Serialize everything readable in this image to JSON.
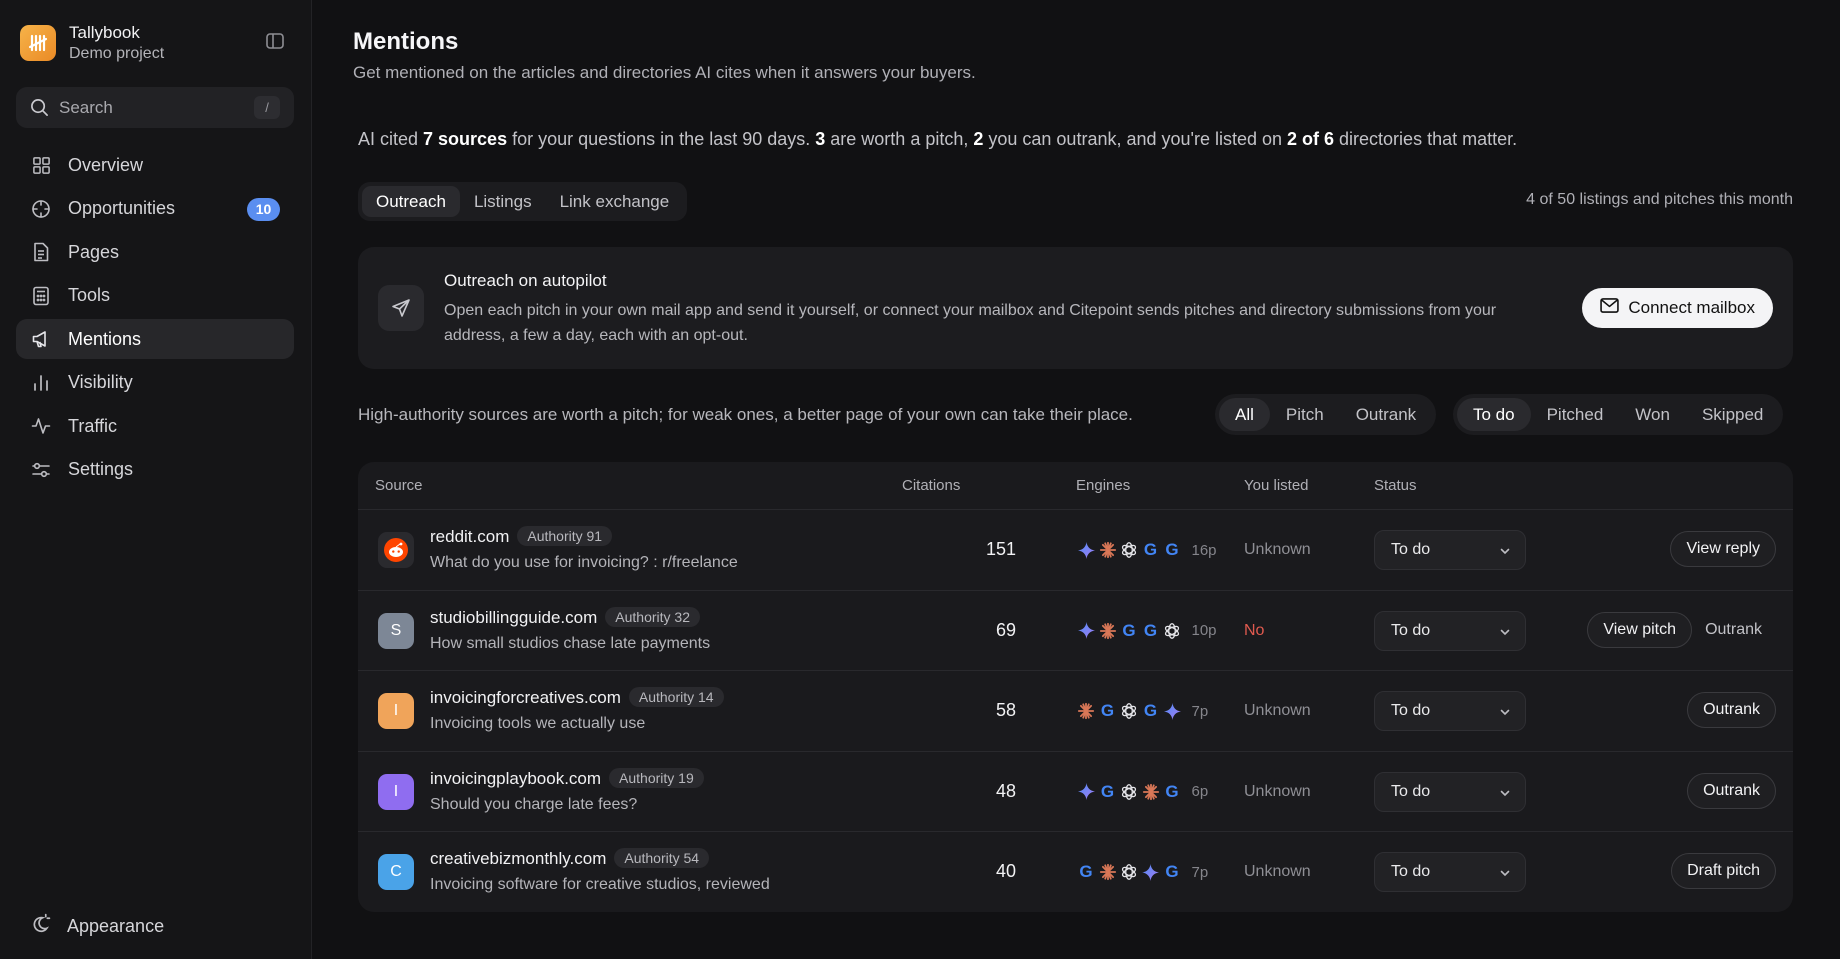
{
  "app": {
    "name": "Tallybook",
    "project": "Demo project"
  },
  "search": {
    "label": "Search",
    "shortcut": "/"
  },
  "nav": [
    {
      "label": "Overview",
      "icon": "grid-icon"
    },
    {
      "label": "Opportunities",
      "icon": "crosshair-icon",
      "badge": "10"
    },
    {
      "label": "Pages",
      "icon": "document-icon"
    },
    {
      "label": "Tools",
      "icon": "calculator-icon"
    },
    {
      "label": "Mentions",
      "icon": "megaphone-icon",
      "active": true
    },
    {
      "label": "Visibility",
      "icon": "bar-chart-icon"
    },
    {
      "label": "Traffic",
      "icon": "activity-icon"
    },
    {
      "label": "Settings",
      "icon": "sliders-icon"
    }
  ],
  "appearance_label": "Appearance",
  "page": {
    "title": "Mentions",
    "subtitle": "Get mentioned on the articles and directories AI cites when it answers your buyers."
  },
  "summary": {
    "p1": "AI cited ",
    "sources": "7 sources",
    "p2": " for your questions in the last 90 days. ",
    "pitch_count": "3",
    "p3": " are worth a pitch, ",
    "outrank_count": "2",
    "p4": " you can outrank, and you're listed on ",
    "directories": "2 of 6",
    "p5": " directories that matter."
  },
  "tabs": [
    "Outreach",
    "Listings",
    "Link exchange"
  ],
  "quota": "4 of 50 listings and pitches this month",
  "autopilot": {
    "title": "Outreach on autopilot",
    "description": "Open each pitch in your own mail app and send it yourself, or connect your mailbox and Citepoint sends pitches and directory submissions from your address, a few a day, each with an opt-out.",
    "button": "Connect mailbox"
  },
  "filter": {
    "text": "High-authority sources are worth a pitch; for weak ones, a better page of your own can take their place.",
    "types": [
      "All",
      "Pitch",
      "Outrank"
    ],
    "statuses": [
      "To do",
      "Pitched",
      "Won",
      "Skipped"
    ]
  },
  "table": {
    "headers": {
      "source": "Source",
      "citations": "Citations",
      "engines": "Engines",
      "listed": "You listed",
      "status": "Status"
    },
    "rows": [
      {
        "domain": "reddit.com",
        "authority": "Authority 91",
        "title": "What do you use for invoicing? : r/freelance",
        "citations": "151",
        "engines": [
          "gemini",
          "claude",
          "openai",
          "google",
          "google"
        ],
        "pages": "16p",
        "listed": "Unknown",
        "status": "To do",
        "avatar": "R",
        "avatar_color": "#ff4500",
        "actions": [
          "View reply"
        ]
      },
      {
        "domain": "studiobillingguide.com",
        "authority": "Authority 32",
        "title": "How small studios chase late payments",
        "citations": "69",
        "engines": [
          "gemini",
          "claude",
          "google",
          "google",
          "openai"
        ],
        "pages": "10p",
        "listed": "No",
        "status": "To do",
        "avatar": "S",
        "avatar_color": "#7d8796",
        "actions": [
          "View pitch",
          "Outrank"
        ]
      },
      {
        "domain": "invoicingforcreatives.com",
        "authority": "Authority 14",
        "title": "Invoicing tools we actually use",
        "citations": "58",
        "engines": [
          "claude",
          "google",
          "openai",
          "google",
          "gemini"
        ],
        "pages": "7p",
        "listed": "Unknown",
        "status": "To do",
        "avatar": "I",
        "avatar_color": "#f0a45a",
        "actions": [
          "Outrank"
        ]
      },
      {
        "domain": "invoicingplaybook.com",
        "authority": "Authority 19",
        "title": "Should you charge late fees?",
        "citations": "48",
        "engines": [
          "gemini",
          "google",
          "openai",
          "claude",
          "google"
        ],
        "pages": "6p",
        "listed": "Unknown",
        "status": "To do",
        "avatar": "I",
        "avatar_color": "#8f6df0",
        "actions": [
          "Outrank"
        ]
      },
      {
        "domain": "creativebizmonthly.com",
        "authority": "Authority 54",
        "title": "Invoicing software for creative studios, reviewed",
        "citations": "40",
        "engines": [
          "google",
          "claude",
          "openai",
          "gemini",
          "google"
        ],
        "pages": "7p",
        "listed": "Unknown",
        "status": "To do",
        "avatar": "C",
        "avatar_color": "#4aa3e8",
        "actions": [
          "Draft pitch"
        ]
      }
    ]
  },
  "colors": {
    "accent_badge": "#5a8ef0",
    "no_listed": "#e05a4f",
    "brand": "#f0a03a"
  }
}
